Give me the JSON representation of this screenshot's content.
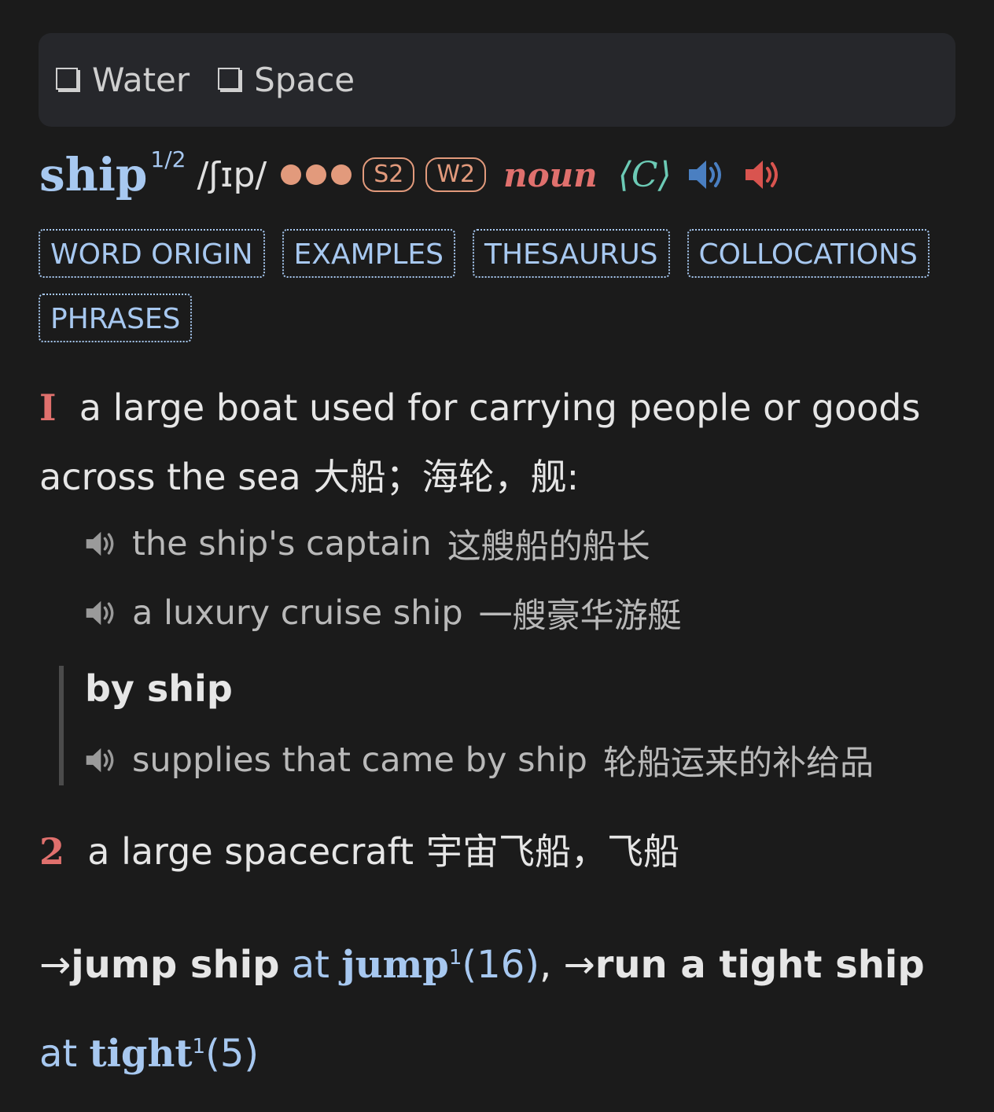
{
  "topics": [
    {
      "label": "Water"
    },
    {
      "label": "Space"
    }
  ],
  "entry": {
    "headword": "ship",
    "homograph": "1/2",
    "pronunciation": "/ʃɪp/",
    "frequency_dots": 3,
    "badges": [
      "S2",
      "W2"
    ],
    "part_of_speech": "noun",
    "grammar": "⟨C⟩",
    "colors": {
      "headword": "#a7c8f0",
      "pos": "#e0706d",
      "badge": "#e29a7c",
      "grammar": "#6ccab5"
    }
  },
  "tabs": [
    "WORD ORIGIN",
    "EXAMPLES",
    "THESAURUS",
    "COLLOCATIONS",
    "PHRASES"
  ],
  "senses": [
    {
      "number": "I",
      "definition": "a large boat used for carrying people or goods across the sea",
      "translation": "大船；海轮，舰:",
      "examples": [
        {
          "en": "the ship's captain",
          "zh": "这艘船的船长"
        },
        {
          "en": "a luxury cruise ship",
          "zh": "一艘豪华游艇"
        }
      ],
      "phrase": {
        "label": "by ship",
        "example": {
          "en": "supplies that came by ship",
          "zh": "轮船运来的补给品"
        }
      }
    },
    {
      "number": "2",
      "definition": "a large spacecraft",
      "translation": "宇宙飞船，飞船"
    }
  ],
  "crossrefs": {
    "arrow": "→",
    "items": [
      {
        "phrase": "jump ship",
        "at": "at",
        "link": "jump",
        "sup": "1",
        "sense": "(16)",
        "sep": ","
      },
      {
        "phrase": "run a tight ship",
        "at": "at",
        "link": "tight",
        "sup": "1",
        "sense": "(5)",
        "sep": ""
      }
    ]
  }
}
